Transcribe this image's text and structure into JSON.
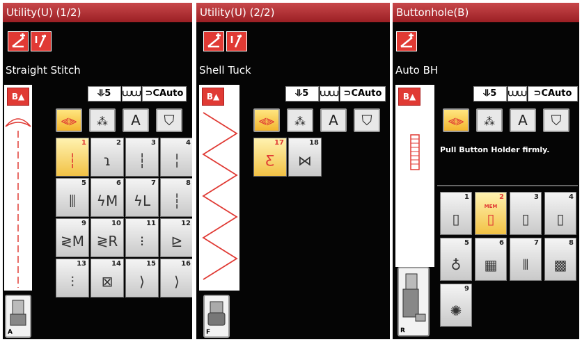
{
  "panels": [
    {
      "title": "Utility(U) (1/2)",
      "stitch_name": "Straight Stitch",
      "foot_letter": "A",
      "status": {
        "feed": "5",
        "tension": "Auto"
      },
      "categories": [
        "sewing-icon",
        "decorative-icon",
        "A",
        "garment-icon"
      ],
      "stitches": [
        {
          "n": "1",
          "g": "┆",
          "sel": true
        },
        {
          "n": "2",
          "g": "ɿ",
          "sel": false
        },
        {
          "n": "3",
          "g": "┆",
          "sel": false
        },
        {
          "n": "4",
          "g": "╎",
          "sel": false
        },
        {
          "n": "5",
          "g": "⫼",
          "sel": false
        },
        {
          "n": "6",
          "g": "ϟM",
          "sel": false
        },
        {
          "n": "7",
          "g": "ϟL",
          "sel": false
        },
        {
          "n": "8",
          "g": "┆",
          "sel": false
        },
        {
          "n": "9",
          "g": "≷M",
          "sel": false
        },
        {
          "n": "10",
          "g": "≷R",
          "sel": false
        },
        {
          "n": "11",
          "g": "⁝",
          "sel": false
        },
        {
          "n": "12",
          "g": "⊵",
          "sel": false
        },
        {
          "n": "13",
          "g": "⫶",
          "sel": false
        },
        {
          "n": "14",
          "g": "⊠",
          "sel": false
        },
        {
          "n": "15",
          "g": "⟩",
          "sel": false
        },
        {
          "n": "16",
          "g": "⟩",
          "sel": false
        }
      ]
    },
    {
      "title": "Utility(U) (2/2)",
      "stitch_name": "Shell Tuck",
      "foot_letter": "F",
      "status": {
        "feed": "5",
        "tension": "Auto"
      },
      "categories": [
        "sewing-icon",
        "decorative-icon",
        "A",
        "garment-icon"
      ],
      "stitches": [
        {
          "n": "17",
          "g": "Ƹ",
          "sel": true
        },
        {
          "n": "18",
          "g": "⋈",
          "sel": false
        }
      ]
    },
    {
      "title": "Buttonhole(B)",
      "stitch_name": "Auto BH",
      "foot_letter": "R",
      "status": {
        "feed": "5",
        "tension": "Auto"
      },
      "categories": [
        "sewing-icon",
        "decorative-icon",
        "A",
        "garment-icon"
      ],
      "message": "Pull Button Holder firmly.",
      "mem_label": "MEM",
      "stitches": [
        {
          "n": "1",
          "g": "▯",
          "sel": false
        },
        {
          "n": "2",
          "g": "▯",
          "sel": true
        },
        {
          "n": "3",
          "g": "▯",
          "sel": false
        },
        {
          "n": "4",
          "g": "▯",
          "sel": false
        },
        {
          "n": "5",
          "g": "♁",
          "sel": false
        },
        {
          "n": "6",
          "g": "▦",
          "sel": false
        },
        {
          "n": "7",
          "g": "⦀",
          "sel": false
        },
        {
          "n": "8",
          "g": "▩",
          "sel": false
        },
        {
          "n": "9",
          "g": "✺",
          "sel": false
        }
      ]
    }
  ]
}
